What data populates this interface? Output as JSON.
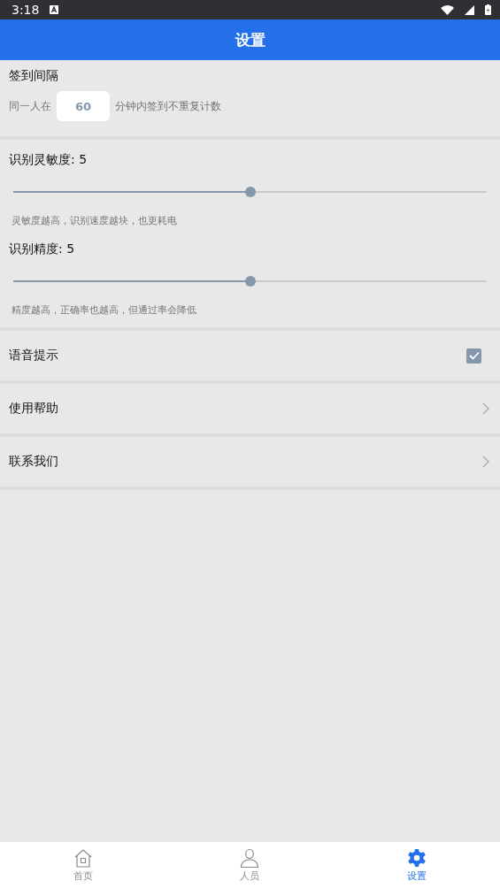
{
  "status_bar": {
    "time": "3:18"
  },
  "header": {
    "title": "设置"
  },
  "interval": {
    "title": "签到间隔",
    "prefix": "同一人在",
    "value": "60",
    "suffix": "分钟内签到不重复计数"
  },
  "sliders": [
    {
      "label": "识别灵敏度: 5",
      "level": 0.5,
      "hint": "灵敏度越高，识别速度越块，也更耗电"
    },
    {
      "label": "识别精度: 5",
      "level": 0.5,
      "hint": "精度越高，正确率也越高，但通过率会降低"
    }
  ],
  "rows": [
    {
      "kind": "checkbox",
      "label": "语音提示",
      "checked": true
    },
    {
      "kind": "link",
      "label": "使用帮助"
    },
    {
      "kind": "link",
      "label": "联系我们"
    }
  ],
  "tabs": [
    {
      "label": "首页",
      "kind": "home",
      "selected": false
    },
    {
      "label": "人员",
      "kind": "person",
      "selected": false
    },
    {
      "label": "设置",
      "kind": "gear",
      "selected": true
    }
  ]
}
